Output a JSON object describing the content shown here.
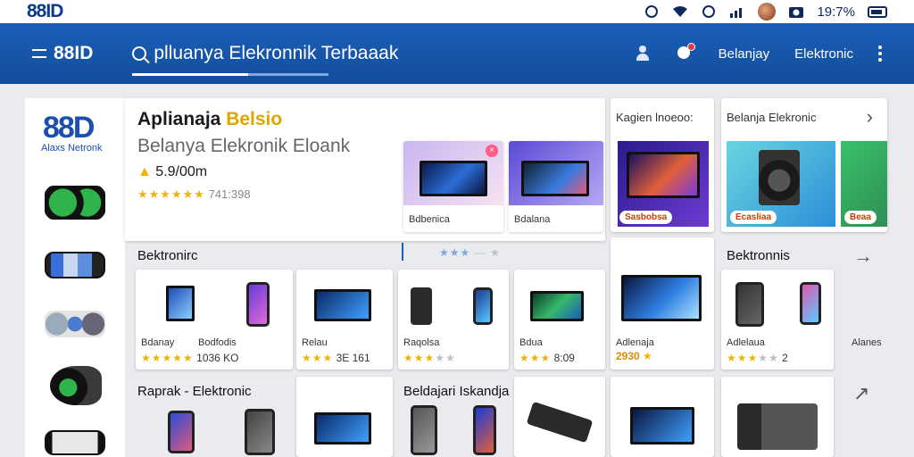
{
  "status_bar": {
    "logo": "88ID",
    "battery": "19:7%",
    "icons": [
      "location-icon",
      "wifi-icon",
      "clock-icon",
      "signal-icon",
      "avatar",
      "camera-icon",
      "battery-icon"
    ]
  },
  "app_bar": {
    "brand": "88ID",
    "search_text": "plluanya Elekronnik Terbaaak",
    "action_1": "Belanjay",
    "action_2": "Elektronic",
    "icons": [
      "menu-icon",
      "search-icon",
      "person-icon",
      "bell-icon",
      "more-icon"
    ]
  },
  "sidebar": {
    "logo": "88D",
    "logo_sub": "Alaxs Netronk"
  },
  "hero": {
    "title_a": "Aplianaja ",
    "title_b": "Belsio",
    "subtitle": "Belanya Elekronik Eloank",
    "price": "5.9/00m",
    "stars": "★★★★★★",
    "rating_text": "741:398"
  },
  "top_cards": [
    {
      "label": "Bdbenica"
    },
    {
      "label": "Bdalana"
    }
  ],
  "promo_cards": [
    {
      "title": "Kagien lnoeoo:",
      "tag": "Sasbobsa"
    },
    {
      "title": "Belanja Elekronic",
      "tag": "Ecasliaa",
      "tag2": "Beaa"
    }
  ],
  "rows": {
    "row1_title": "Bektronirc",
    "row1_right_title": "Bektronnis",
    "row2_title": "Raprak - Elektronic",
    "row2_mid_title": "Beldajari Iskandja",
    "products_row1": [
      {
        "label": "Bdanay",
        "label2": "Bodfodis",
        "price": "1036 KO"
      },
      {
        "label": "Relau",
        "price": "3E   161"
      },
      {
        "label": "Raqolsa",
        "price": ""
      },
      {
        "label": "Bdua",
        "price": "8:09"
      },
      {
        "label": "Adlenaja",
        "price": "2930"
      },
      {
        "label": "Adlelaua",
        "price": "2"
      }
    ],
    "products_row1_extra": "Alanes"
  },
  "colors": {
    "primary": "#1b5fb8",
    "accent_yellow": "#f5d300",
    "star": "#f2b400"
  }
}
